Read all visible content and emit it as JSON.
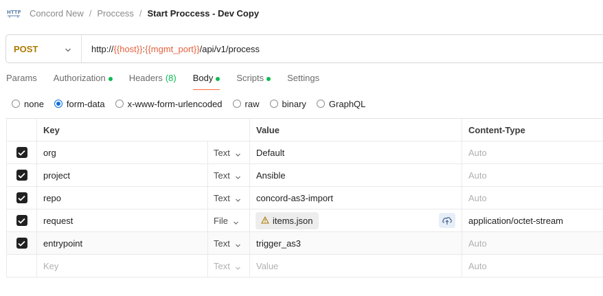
{
  "breadcrumb": {
    "icon": "http-icon",
    "items": [
      "Concord New",
      "Proccess"
    ],
    "separator": "/",
    "current": "Start Proccess - Dev Copy"
  },
  "request": {
    "method": "POST",
    "url_prefix": "http://",
    "url_var1": "{{host}}",
    "url_colon": ":",
    "url_var2": "{{mgmt_port}}",
    "url_suffix": "/api/v1/process"
  },
  "tabs": [
    {
      "label": "Params"
    },
    {
      "label": "Authorization"
    },
    {
      "label": "Headers",
      "count": "(8)"
    },
    {
      "label": "Body"
    },
    {
      "label": "Scripts"
    },
    {
      "label": "Settings"
    }
  ],
  "body_types": [
    "none",
    "form-data",
    "x-www-form-urlencoded",
    "raw",
    "binary",
    "GraphQL"
  ],
  "selected_body_type": "form-data",
  "table": {
    "headers": {
      "key": "Key",
      "value": "Value",
      "content_type": "Content-Type"
    },
    "rows": [
      {
        "key": "org",
        "type": "Text",
        "value": "Default",
        "content_type": "Auto"
      },
      {
        "key": "project",
        "type": "Text",
        "value": "Ansible",
        "content_type": "Auto"
      },
      {
        "key": "repo",
        "type": "Text",
        "value": "concord-as3-import",
        "content_type": "Auto"
      },
      {
        "key": "request",
        "type": "File",
        "value": "items.json",
        "content_type": "application/octet-stream"
      },
      {
        "key": "entrypoint",
        "type": "Text",
        "value": "trigger_as3",
        "content_type": "Auto"
      }
    ],
    "empty_row": {
      "key": "Key",
      "type": "Text",
      "value": "Value",
      "content_type": "Auto"
    }
  },
  "colors": {
    "method": "#ad7a03",
    "variable": "#e5603b",
    "active_tab_underline": "#ff6c37",
    "status_dot": "#0cbb52",
    "radio_selected": "#0a6fe0"
  }
}
